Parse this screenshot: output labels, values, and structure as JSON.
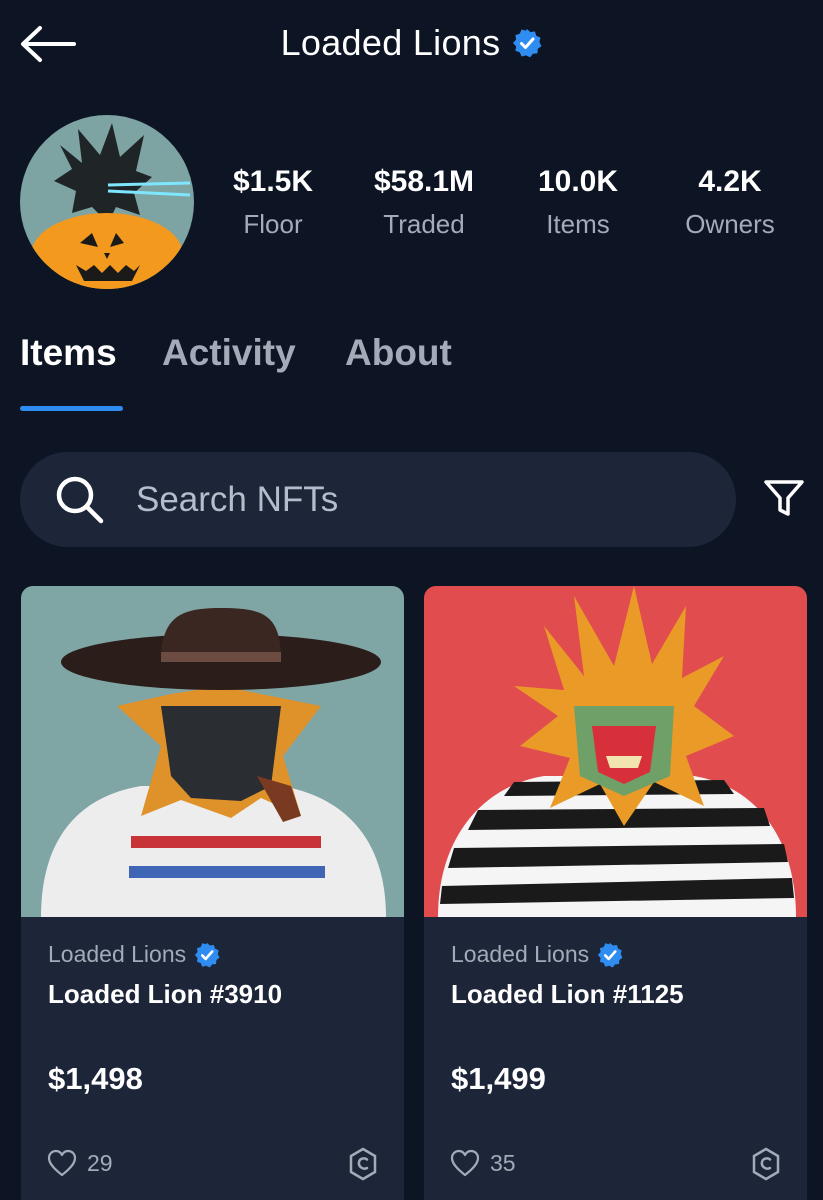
{
  "header": {
    "title": "Loaded Lions",
    "back_icon": "arrow-left-icon",
    "verified_icon": "verified-badge-icon"
  },
  "stats": [
    {
      "value": "$1.5K",
      "label": "Floor"
    },
    {
      "value": "$58.1M",
      "label": "Traded"
    },
    {
      "value": "10.0K",
      "label": "Items"
    },
    {
      "value": "4.2K",
      "label": "Owners"
    }
  ],
  "tabs": [
    {
      "label": "Items",
      "active": true
    },
    {
      "label": "Activity",
      "active": false
    },
    {
      "label": "About",
      "active": false
    }
  ],
  "search": {
    "placeholder": "Search NFTs",
    "value": ""
  },
  "cards": [
    {
      "collection": "Loaded Lions",
      "name": "Loaded Lion #3910",
      "price": "$1,498",
      "likes": "29",
      "background": "#7fa5a5"
    },
    {
      "collection": "Loaded Lions",
      "name": "Loaded Lion #1125",
      "price": "$1,499",
      "likes": "35",
      "background": "#e14c4f"
    }
  ],
  "colors": {
    "background": "#0d1423",
    "surface": "#1d2538",
    "accent": "#2f8cf0",
    "muted_text": "#a3aab8"
  }
}
